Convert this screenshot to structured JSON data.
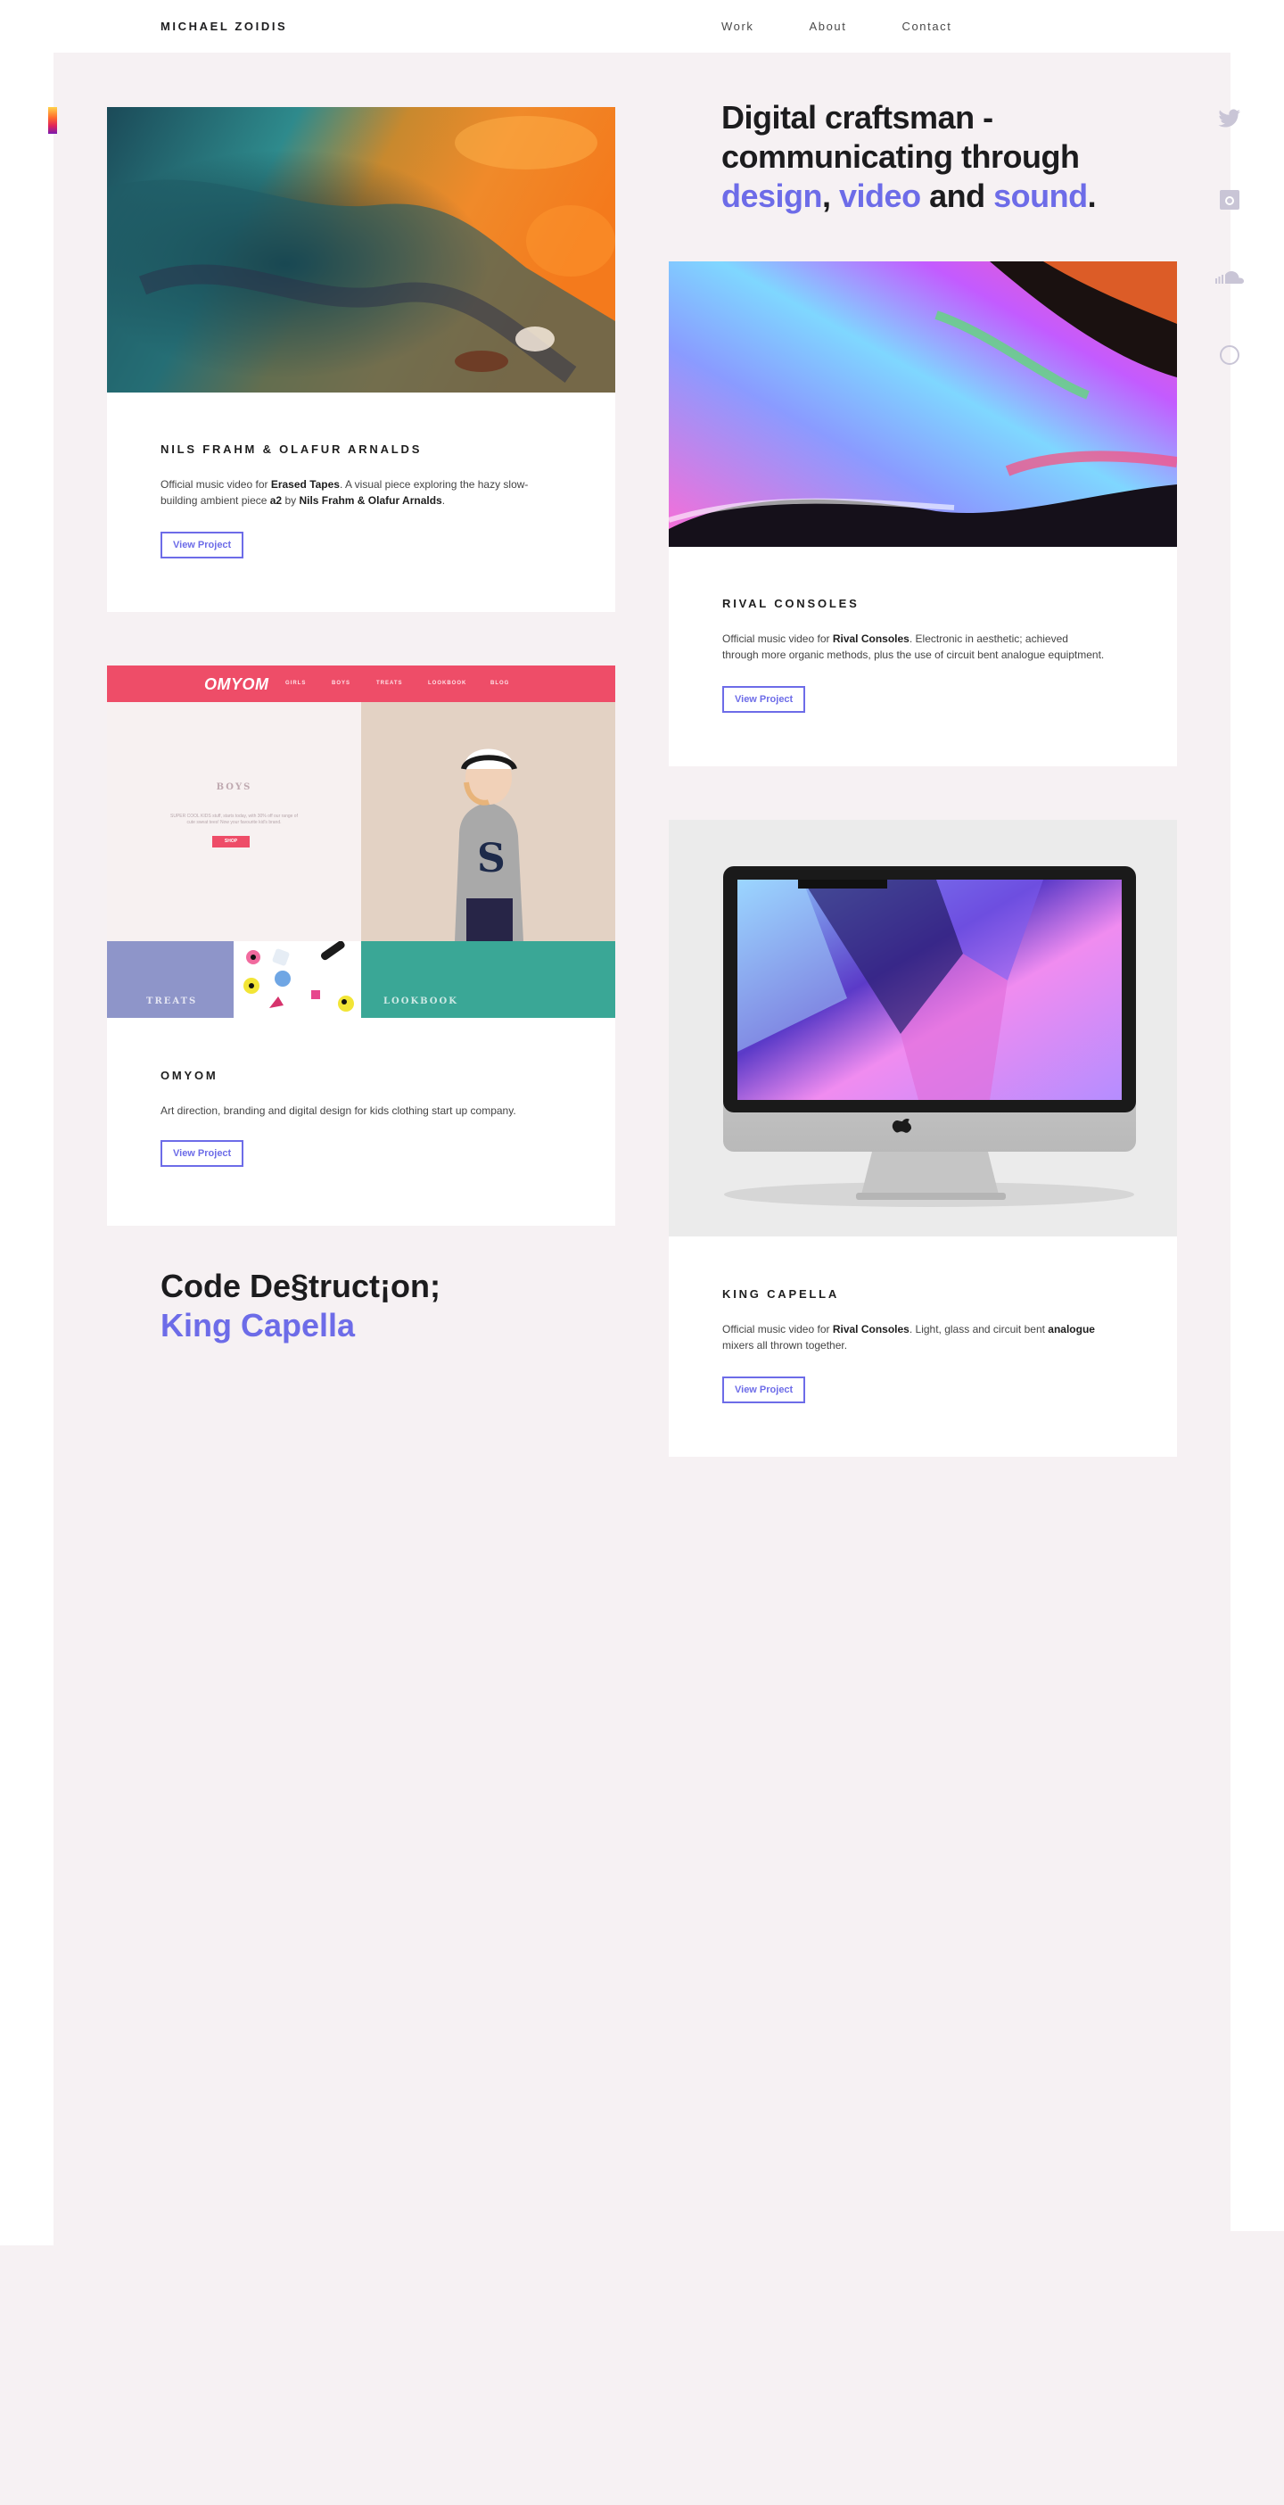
{
  "header": {
    "brand": "MICHAEL ZOIDIS",
    "nav": [
      "Work",
      "About",
      "Contact"
    ]
  },
  "intro": {
    "line1": "Digital craftsman -",
    "line2": "communicating through",
    "word_design": "design",
    "sep1": ", ",
    "word_video": "video",
    "sep2": " and ",
    "word_sound": "sound",
    "end": "."
  },
  "social": [
    "twitter-icon",
    "instagram-icon",
    "soundcloud-icon",
    "dribbble-icon"
  ],
  "projects": [
    {
      "title": "NILS FRAHM & OLAFUR ARNALDS",
      "desc_1": "Official music video for ",
      "desc_b1": "Erased Tapes",
      "desc_2": ". A visual piece exploring the hazy slow-building ambient piece ",
      "desc_b2": "a2",
      "desc_3": " by ",
      "desc_b3": "Nils Frahm & Olafur Arnalds",
      "desc_4": ".",
      "button": "View Project"
    },
    {
      "title": "RIVAL CONSOLES",
      "desc_1": "Official music video for ",
      "desc_b1": "Rival Consoles",
      "desc_2": ". Electronic in aesthetic; achieved through more organic methods, plus the use of circuit bent analogue equiptment.",
      "button": "View Project"
    },
    {
      "title": "OMYOM",
      "desc": "Art direction, branding and digital design for kids clothing start up company.",
      "button": "View Project",
      "mock": {
        "logo": "OMYOM",
        "nav": [
          "GIRLS",
          "BOYS",
          "TREATS",
          "LOOKBOOK",
          "BLOG"
        ],
        "section_title": "BOYS",
        "section_text": "SUPER COOL KIDS stuff, starts today, with 30% off our range of cute sweat tees! Now your favourite kid's brand.",
        "section_button": "SHOP",
        "tile_treats": "TREATS",
        "tile_lookbook": "LOOKBOOK"
      }
    },
    {
      "title": "KING CAPELLA",
      "desc_1": "Official music video for ",
      "desc_b1": "Rival Consoles",
      "desc_2": ". Light, glass and circuit bent ",
      "desc_b2": "analogue",
      "desc_3": " mixers all thrown together.",
      "button": "View Project"
    }
  ],
  "feature": {
    "line1": "Code De§truct¡on;",
    "line2": "King Capella"
  },
  "colors": {
    "accent": "#6d6ce8",
    "page_bg": "#f6f1f3",
    "omyom_pink": "#ee4d68",
    "omyom_teal": "#3aa796",
    "omyom_lavender": "#8e95c9"
  }
}
